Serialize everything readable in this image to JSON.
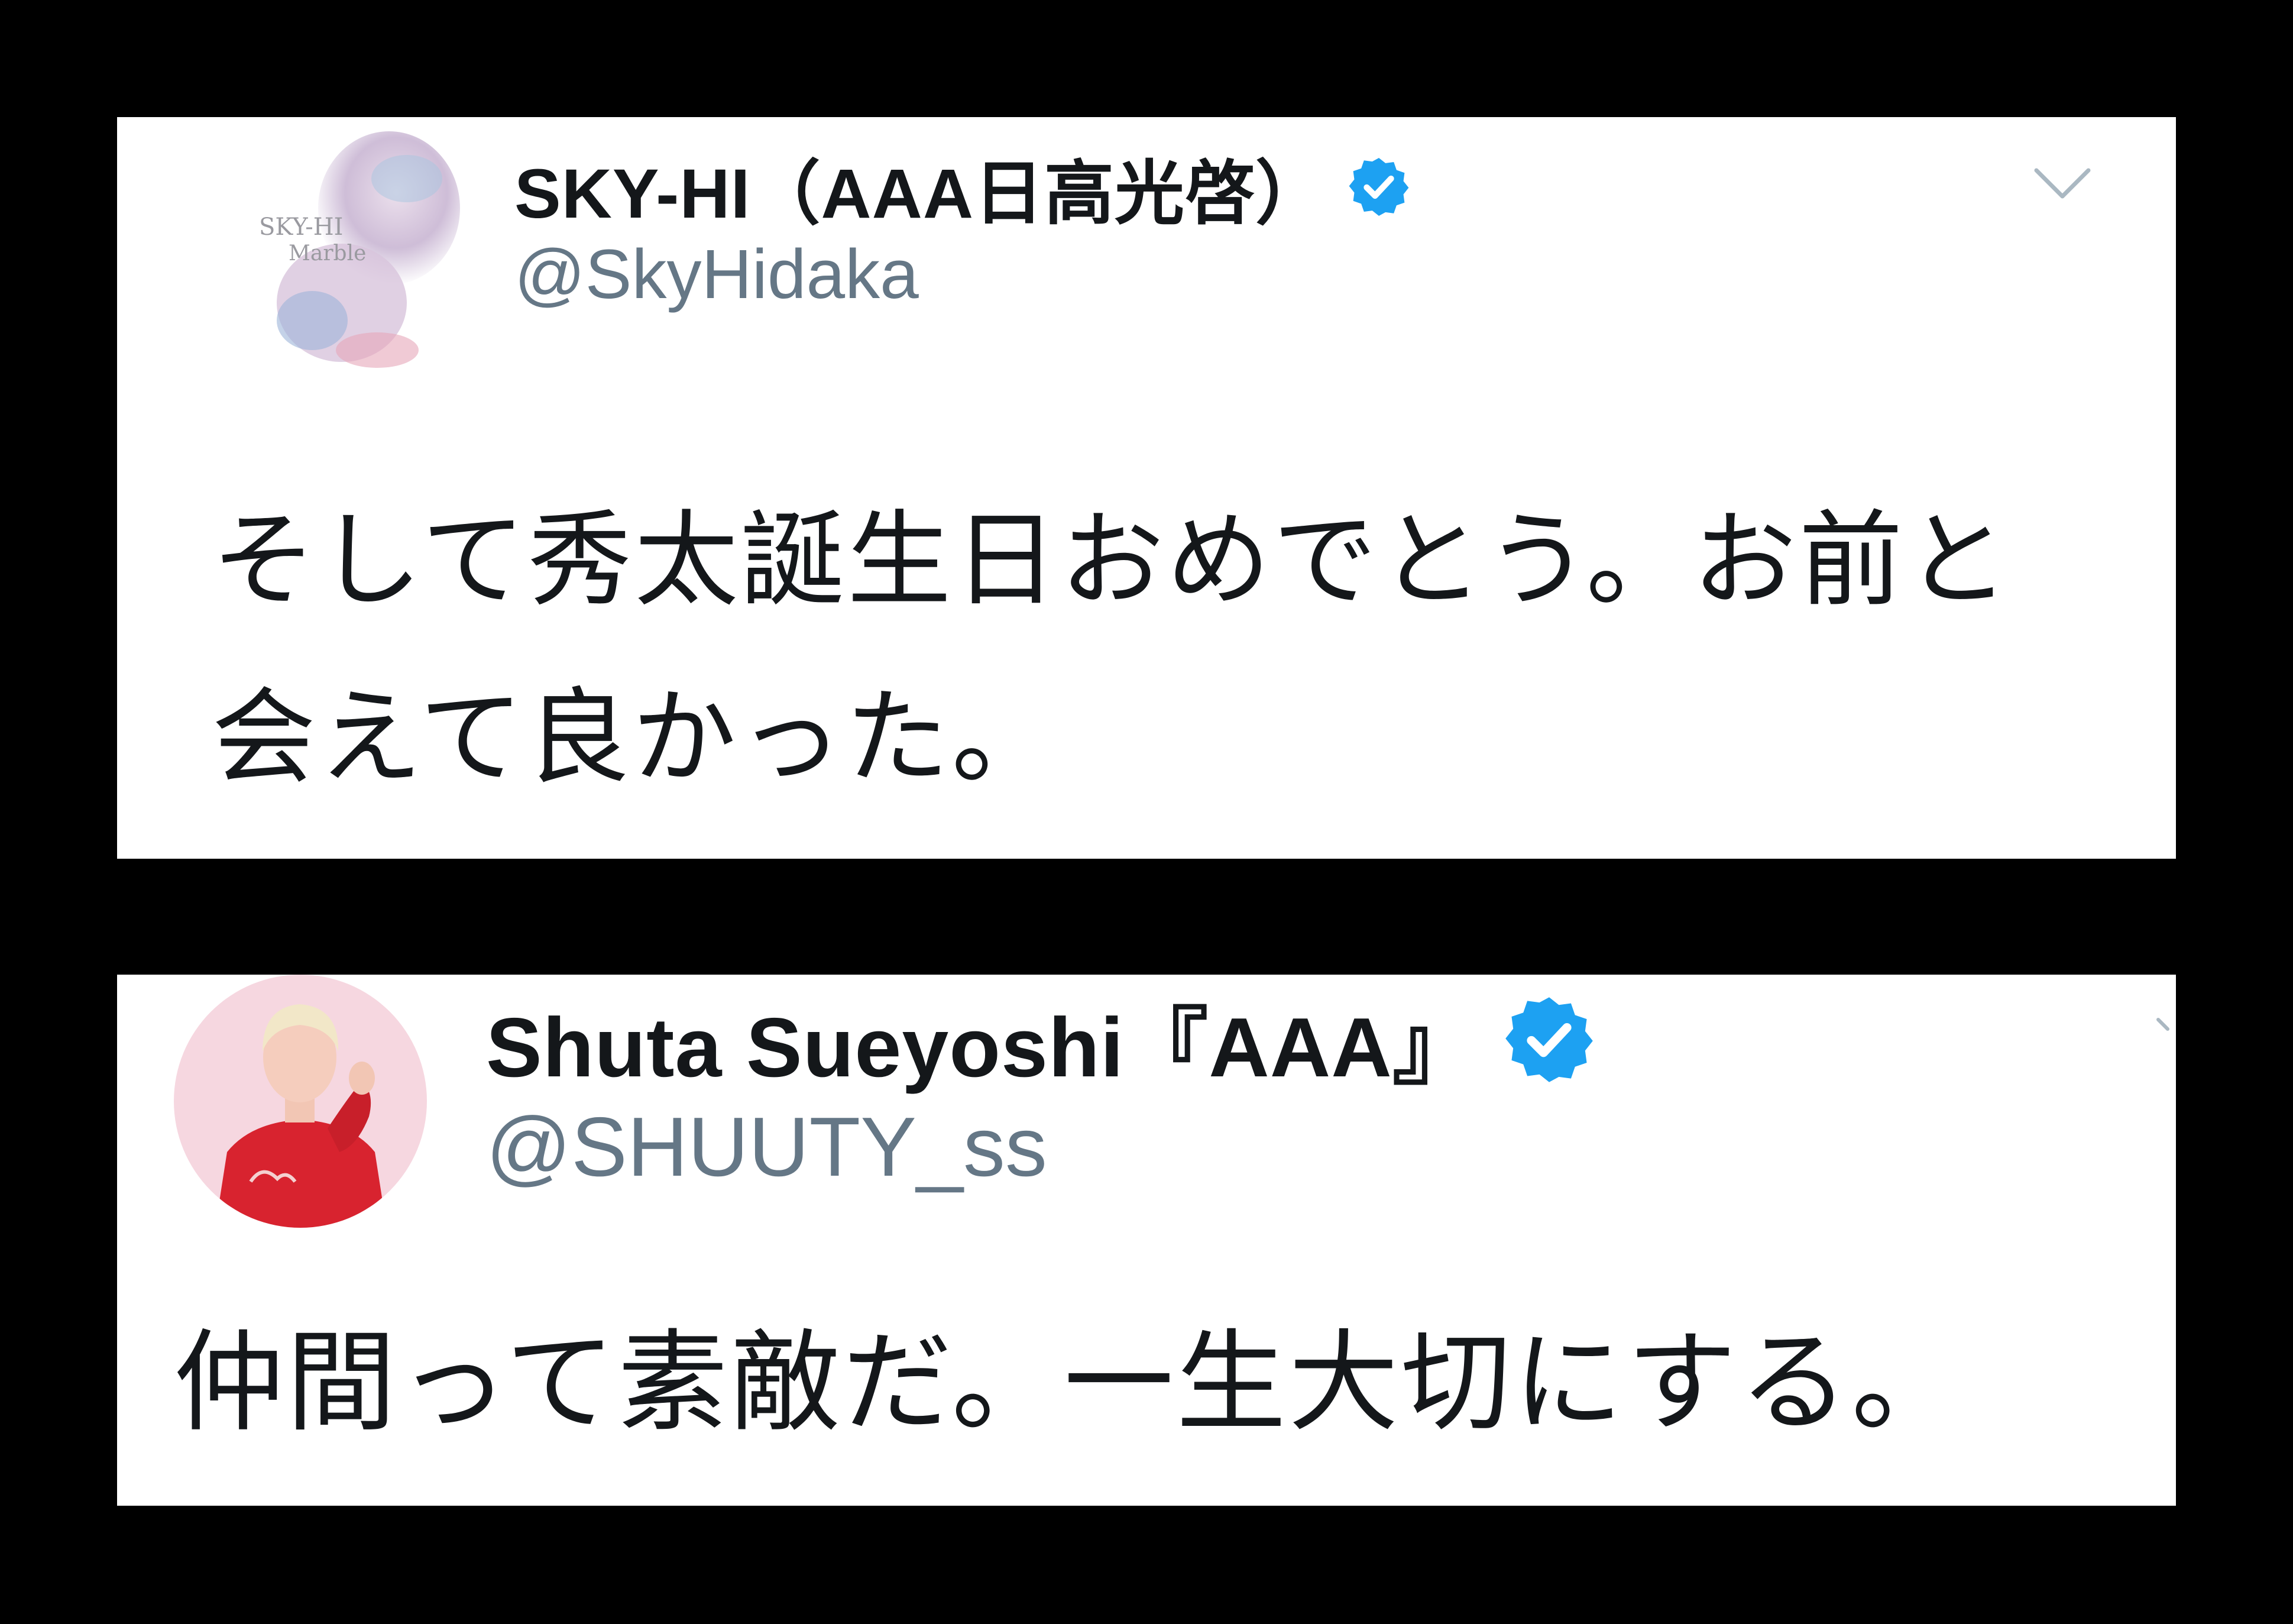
{
  "tweets": [
    {
      "display_name": "SKY-HI（AAA日高光啓）",
      "handle": "@SkyHidaka",
      "text": "そして秀太誕生日おめでとう。お前と会えて良かった。",
      "avatar_text": [
        "SKY-HI",
        "Marble"
      ],
      "verified": true
    },
    {
      "display_name": "Shuta Sueyoshi『AAA』",
      "handle": "@SHUUTY_ss",
      "text": "仲間って素敵だ。一生大切にする。",
      "verified": true
    }
  ],
  "icons": {
    "verified": "verified-badge-icon",
    "caret": "chevron-down-icon"
  },
  "colors": {
    "background": "#000000",
    "card": "#ffffff",
    "name": "#14171a",
    "handle": "#657786",
    "verified": "#1da1f2"
  }
}
